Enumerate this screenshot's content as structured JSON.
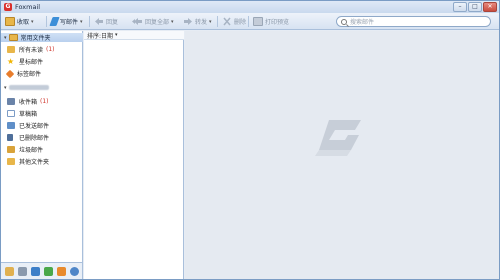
{
  "app": {
    "title": "Foxmail",
    "logo_letter": "G"
  },
  "window_controls": {
    "minimize": "–",
    "maximize": "□",
    "close": "✕"
  },
  "toolbar": {
    "receive": "收取",
    "compose": "写邮件",
    "reply": "回复",
    "reply_all": "回复全部",
    "forward": "转发",
    "delete": "删除",
    "print_preview": "打印预览",
    "dropdown_arrow": "▾"
  },
  "search": {
    "placeholder": "搜索邮件"
  },
  "sidebar": {
    "common_group": {
      "label": "常用文件夹",
      "expander": "▾"
    },
    "common_items": [
      {
        "label": "所有未读",
        "badge": "(1)",
        "icon": "unread-folder-icon",
        "color": "#e8b64a"
      },
      {
        "label": "星标邮件",
        "badge": "",
        "icon": "star-icon",
        "color": "#f0b400"
      },
      {
        "label": "标签邮件",
        "badge": "",
        "icon": "tag-icon",
        "color": "#e87d2c"
      }
    ],
    "account": {
      "expander": "▾"
    },
    "account_items": [
      {
        "label": "收件箱",
        "badge": "(1)",
        "icon": "inbox-icon",
        "color": "#6a83a8"
      },
      {
        "label": "草稿箱",
        "badge": "",
        "icon": "drafts-icon",
        "color": "#7c9cc6"
      },
      {
        "label": "已发送邮件",
        "badge": "",
        "icon": "sent-icon",
        "color": "#5f8fc8"
      },
      {
        "label": "已删除邮件",
        "badge": "",
        "icon": "trash-icon",
        "color": "#4f6f9a"
      },
      {
        "label": "垃圾邮件",
        "badge": "",
        "icon": "spam-icon",
        "color": "#d9a33a"
      },
      {
        "label": "其他文件夹",
        "badge": "",
        "icon": "folder-icon",
        "color": "#e8b64a"
      }
    ]
  },
  "message_list": {
    "sort_label": "排序:日期",
    "sort_arrow": "▾"
  },
  "colors": {
    "accent": "#3d6fb3",
    "badge": "#d0352b",
    "preview_bg": "#e5eaf1"
  }
}
